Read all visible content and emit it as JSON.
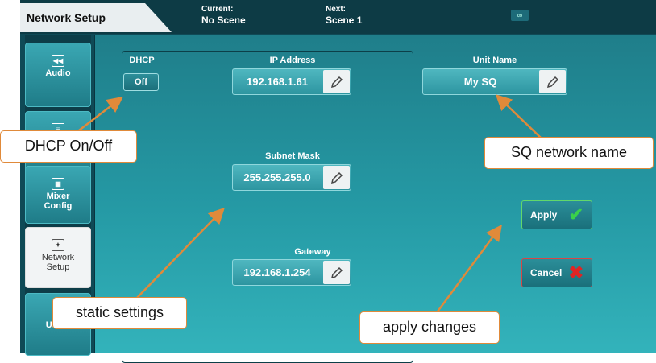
{
  "header": {
    "title": "Network Setup",
    "current_label": "Current:",
    "current_value": "No Scene",
    "next_label": "Next:",
    "next_value": "Scene 1",
    "link_icon": "chain-link-icon"
  },
  "sidebar": {
    "items": [
      {
        "label": "Audio",
        "icon": "audio-icon"
      },
      {
        "label": "",
        "icon": "keyboard-icon"
      },
      {
        "label": "Mixer Config",
        "icon": "mixer-config-icon"
      },
      {
        "label": "Network Setup",
        "icon": "network-icon",
        "active": true
      },
      {
        "label": "Users",
        "icon": "users-icon"
      }
    ]
  },
  "dhcp": {
    "label": "DHCP",
    "button": "Off"
  },
  "ip": {
    "label": "IP Address",
    "value": "192.168.1.61"
  },
  "subnet": {
    "label": "Subnet Mask",
    "value": "255.255.255.0"
  },
  "gateway": {
    "label": "Gateway",
    "value": "192.168.1.254"
  },
  "unit": {
    "label": "Unit Name",
    "value": "My SQ"
  },
  "buttons": {
    "apply": "Apply",
    "cancel": "Cancel"
  },
  "callouts": {
    "dhcp": "DHCP On/Off",
    "network_name": "SQ network name",
    "static": "static settings",
    "apply": "apply changes"
  },
  "colors": {
    "accent": "#2a9aa6",
    "callout_border": "#e08a3a",
    "apply_green": "#3ad14a",
    "cancel_red": "#e02424"
  }
}
